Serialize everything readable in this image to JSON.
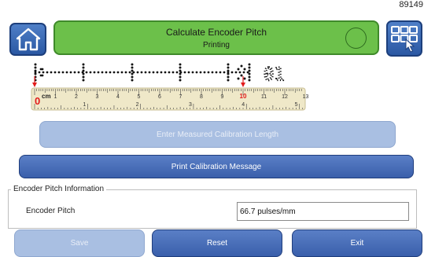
{
  "page_number": "89149",
  "header": {
    "title": "Calculate Encoder Pitch",
    "status": "Printing",
    "status_color": "#6cc04a"
  },
  "icons": {
    "home": "home-icon",
    "menu": "grid-menu-icon",
    "status": "status-circle-icon"
  },
  "ruler": {
    "print_text": "01",
    "unit": "cm",
    "zero_label": "0",
    "cm_ticks": [
      "1",
      "2",
      "3",
      "4",
      "5",
      "6",
      "7",
      "8",
      "9",
      "10",
      "11",
      "12",
      "13"
    ],
    "inch_ticks": [
      "1",
      "2",
      "3",
      "4",
      "5"
    ],
    "marker_color": "#e21b1b"
  },
  "buttons": {
    "enter_length": "Enter Measured Calibration Length",
    "print_message": "Print Calibration Message",
    "save": "Save",
    "reset": "Reset",
    "exit": "Exit"
  },
  "encoder_info": {
    "legend": "Encoder Pitch Information",
    "label": "Encoder Pitch",
    "value": "66.7 pulses/mm"
  }
}
